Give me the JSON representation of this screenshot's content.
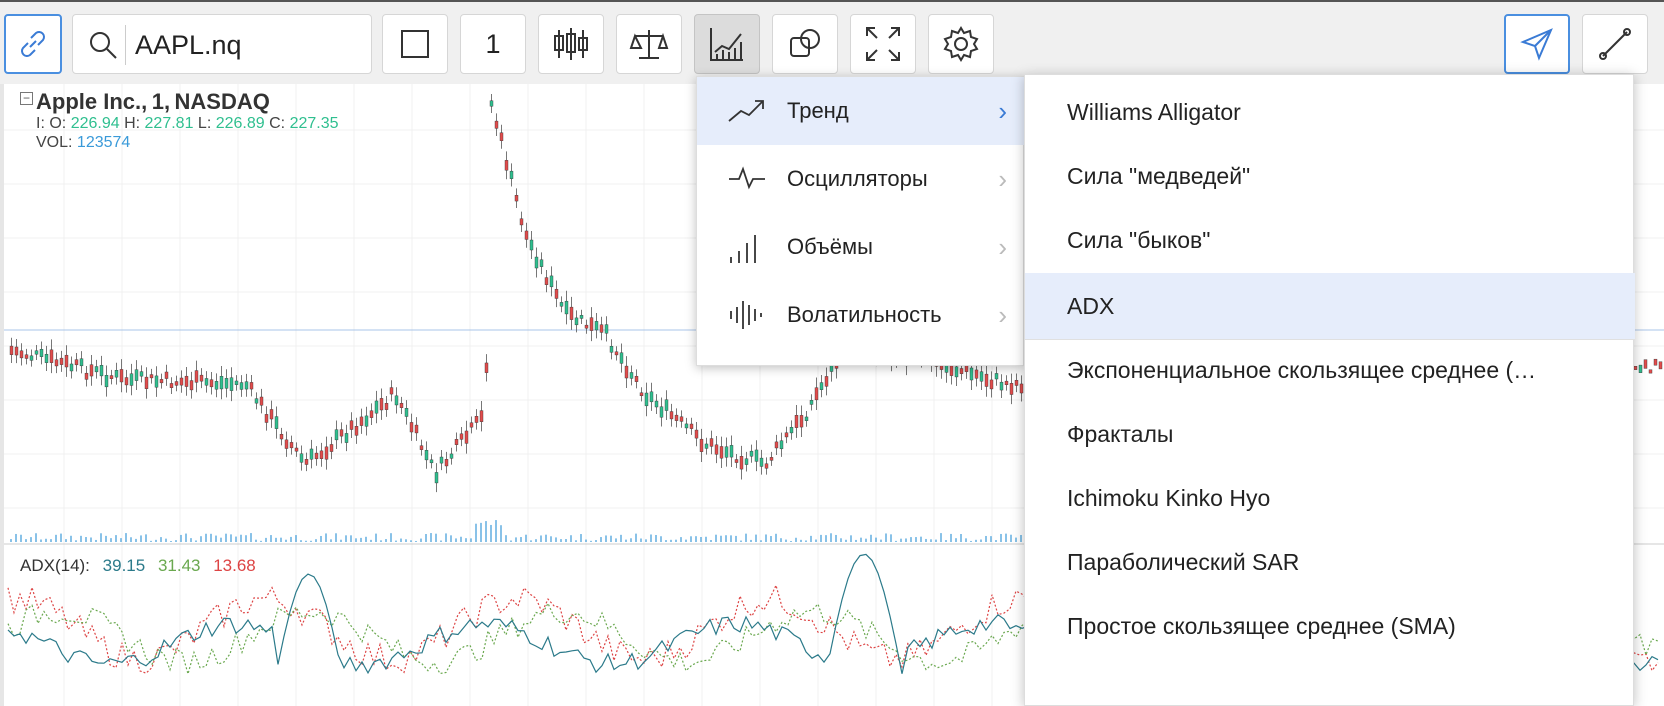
{
  "toolbar": {
    "link_icon": "link-icon",
    "search": {
      "value": "AAPL.nq",
      "icon": "search-icon"
    },
    "items": [
      {
        "name": "chart-type-square",
        "icon": "square-icon"
      },
      {
        "name": "interval",
        "label": "1"
      },
      {
        "name": "candlestick",
        "icon": "candlestick-icon"
      },
      {
        "name": "compare",
        "icon": "scales-icon"
      },
      {
        "name": "indicators",
        "icon": "indicators-icon"
      },
      {
        "name": "shapes",
        "icon": "shapes-icon"
      },
      {
        "name": "fullscreen",
        "icon": "fullscreen-icon"
      },
      {
        "name": "settings",
        "icon": "gear-icon"
      }
    ],
    "right": [
      {
        "name": "cursor",
        "icon": "cursor-arrow-icon"
      },
      {
        "name": "line-tool",
        "icon": "line-icon"
      }
    ]
  },
  "chart": {
    "title": "Apple Inc.,",
    "interval": "1,",
    "exchange": "NASDAQ",
    "o_label": "I: O:",
    "o": "226.94",
    "h_label": "H:",
    "h": "227.81",
    "l_label": "L:",
    "l": "226.89",
    "c_label": "C:",
    "c": "227.35",
    "vol_label": "VOL:",
    "vol": "123574",
    "colors": {
      "up": "#2fbf8f",
      "down": "#e24c4c",
      "volume": "#3a9ad9"
    }
  },
  "adx": {
    "label": "ADX(14):",
    "v1": "39.15",
    "v2": "31.43",
    "v3": "13.68",
    "colors": {
      "v1": "#2b7a8a",
      "v2": "#6aa84f",
      "v3": "#d44"
    }
  },
  "menu_categories": [
    {
      "label": "Тренд",
      "icon": "trend-icon",
      "active": true
    },
    {
      "label": "Осцилляторы",
      "icon": "oscillator-icon",
      "active": false
    },
    {
      "label": "Объёмы",
      "icon": "volume-bars-icon",
      "active": false
    },
    {
      "label": "Волатильность",
      "icon": "volatility-icon",
      "active": false
    }
  ],
  "menu_indicators": [
    {
      "label": "Williams Alligator"
    },
    {
      "label": "Сила \"медведей\""
    },
    {
      "label": "Сила \"быков\""
    },
    {
      "label": "ADX",
      "active": true
    },
    {
      "label": "Экспоненциальное скользящее среднее (…"
    },
    {
      "label": "Фракталы"
    },
    {
      "label": "Ichimoku Kinko Hyo"
    },
    {
      "label": "Параболический SAR"
    },
    {
      "label": "Простое скользящее среднее (SMA)"
    }
  ]
}
